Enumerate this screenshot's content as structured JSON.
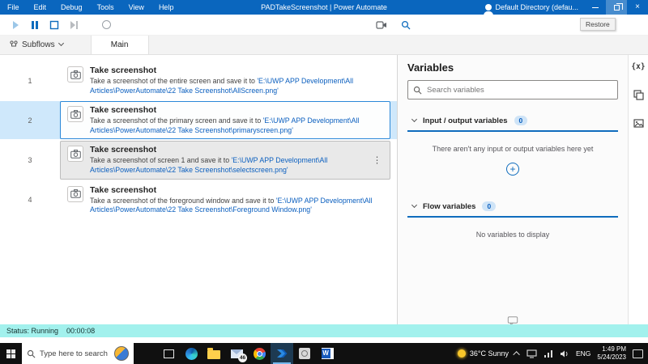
{
  "titlebar": {
    "menu": [
      "File",
      "Edit",
      "Debug",
      "Tools",
      "View",
      "Help"
    ],
    "title": "PADTakeScreenshot | Power Automate",
    "account": "Default Directory (defau...",
    "restore_tooltip": "Restore"
  },
  "tabs": {
    "subflows_label": "Subflows",
    "main_label": "Main"
  },
  "flow": {
    "actions": [
      {
        "num": "1",
        "title": "Take screenshot",
        "desc": "Take a screenshot of the entire screen and save it to ",
        "path": "'E:\\UWP APP Development\\All Articles\\PowerAutomate\\22 Take Screenshot\\AllScreen.png'"
      },
      {
        "num": "2",
        "title": "Take screenshot",
        "desc": "Take a screenshot of the primary screen and save it to ",
        "path": "'E:\\UWP APP Development\\All Articles\\PowerAutomate\\22 Take Screenshot\\primaryscreen.png'"
      },
      {
        "num": "3",
        "title": "Take screenshot",
        "desc": "Take a screenshot of screen 1 and save it to ",
        "path": "'E:\\UWP APP Development\\All Articles\\PowerAutomate\\22 Take Screenshot\\selectscreen.png'"
      },
      {
        "num": "4",
        "title": "Take screenshot",
        "desc": "Take a screenshot of the foreground window and save it to ",
        "path": "'E:\\UWP APP Development\\All Articles\\PowerAutomate\\22 Take Screenshot\\Foreground Window.png'"
      }
    ]
  },
  "variables": {
    "title": "Variables",
    "search_placeholder": "Search variables",
    "io_section": {
      "label": "Input / output variables",
      "count": "0",
      "empty": "There aren't any input or output variables here yet"
    },
    "flow_section": {
      "label": "Flow variables",
      "count": "0",
      "empty": "No variables to display"
    }
  },
  "status": {
    "label": "Status: Running",
    "elapsed": "00:00:08"
  },
  "taskbar": {
    "search_placeholder": "Type here to search",
    "badge": "46",
    "weather": "36°C Sunny",
    "language": "ENG",
    "time": "1:49 PM",
    "date": "5/24/2023"
  },
  "colors": {
    "titlebar": "#0a66be",
    "accent": "#0f6cbd",
    "status_bg": "#a2f1ed"
  }
}
